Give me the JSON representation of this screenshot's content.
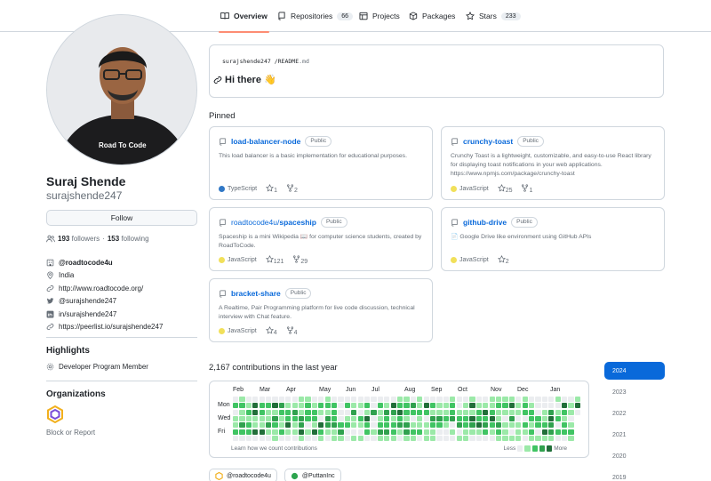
{
  "nav": {
    "tabs": [
      {
        "label": "Overview",
        "icon": "book-icon",
        "active": true
      },
      {
        "label": "Repositories",
        "icon": "repo-icon",
        "count": "66"
      },
      {
        "label": "Projects",
        "icon": "table-icon"
      },
      {
        "label": "Packages",
        "icon": "package-icon"
      },
      {
        "label": "Stars",
        "icon": "star-icon",
        "count": "233"
      }
    ]
  },
  "profile": {
    "avatar_badge": "Road To Code",
    "full_name": "Suraj Shende",
    "username": "surajshende247",
    "follow_label": "Follow",
    "followers_count": "193",
    "followers_label": "followers",
    "separator": "·",
    "following_count": "153",
    "following_label": "following",
    "details": [
      {
        "icon": "organization-icon",
        "text": "@roadtocode4u",
        "bold": true
      },
      {
        "icon": "location-icon",
        "text": "India"
      },
      {
        "icon": "link-icon",
        "text": "http://www.roadtocode.org/"
      },
      {
        "icon": "twitter-icon",
        "text": "@surajshende247"
      },
      {
        "icon": "linkedin-icon",
        "text": "in/surajshende247"
      },
      {
        "icon": "link-icon",
        "text": "https://peerlist.io/surajshende247"
      }
    ],
    "highlights_title": "Highlights",
    "highlight_item": "Developer Program Member",
    "organizations_title": "Organizations",
    "block_report": "Block or Report"
  },
  "readme": {
    "user": "surajshende247",
    "slash": "/",
    "file": "README",
    "ext": ".md",
    "heading": "Hi there 👋"
  },
  "pinned": {
    "title": "Pinned",
    "cards": [
      {
        "owner": "",
        "name": "load-balancer-node",
        "visibility": "Public",
        "description": "This load balancer is a basic implementation for educational purposes.",
        "language": "TypeScript",
        "lang_color": "#3178c6",
        "stars": "1",
        "forks": "2"
      },
      {
        "owner": "",
        "name": "crunchy-toast",
        "visibility": "Public",
        "description": "Crunchy Toast is a lightweight, customizable, and easy-to-use React library for displaying toast notifications in your web applications. https://www.npmjs.com/package/crunchy-toast",
        "language": "JavaScript",
        "lang_color": "#f1e05a",
        "stars": "25",
        "forks": "1"
      },
      {
        "owner": "roadtocode4u/",
        "name": "spaceship",
        "visibility": "Public",
        "description": "Spaceship is a mini Wikipedia 📖 for computer science students, created by RoadToCode.",
        "language": "JavaScript",
        "lang_color": "#f1e05a",
        "stars": "121",
        "forks": "29"
      },
      {
        "owner": "",
        "name": "github-drive",
        "visibility": "Public",
        "description": "📄 Google Drive like environment using GitHub APIs",
        "language": "JavaScript",
        "lang_color": "#f1e05a",
        "stars": "2",
        "forks": ""
      },
      {
        "owner": "",
        "name": "bracket-share",
        "visibility": "Public",
        "description": "A Realtime, Pair Programming platform for live code discussion, technical interview with Chat feature.",
        "language": "JavaScript",
        "lang_color": "#f1e05a",
        "stars": "4",
        "forks": "4"
      }
    ]
  },
  "contributions": {
    "title": "2,167 contributions in the last year",
    "months": [
      "Feb",
      "Mar",
      "Apr",
      "May",
      "Jun",
      "Jul",
      "Aug",
      "Sep",
      "Oct",
      "Nov",
      "Dec",
      "Jan"
    ],
    "days": [
      "Mon",
      "Wed",
      "Fri"
    ],
    "learn": "Learn how we count contributions",
    "less": "Less",
    "more": "More",
    "level_colors": [
      "#ebedf0",
      "#9be9a8",
      "#40c463",
      "#30a14e",
      "#216e39"
    ],
    "orgs": [
      "@roadtocode4u",
      "@PuttanInc"
    ],
    "years": [
      "2024",
      "2023",
      "2022",
      "2021",
      "2020",
      "2019"
    ],
    "active_year": "2024"
  }
}
